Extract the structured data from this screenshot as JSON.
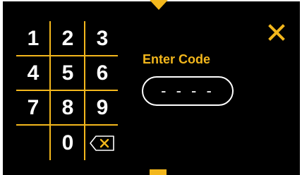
{
  "title": "Enter Code",
  "code_field": {
    "value": "- - - -"
  },
  "keypad": {
    "keys": [
      "1",
      "2",
      "3",
      "4",
      "5",
      "6",
      "7",
      "8",
      "9",
      "0"
    ]
  },
  "icons": {
    "close": "close-icon",
    "backspace": "backspace-icon"
  },
  "colors": {
    "accent": "#f3b71c",
    "background": "#000000",
    "text": "#ffffff"
  }
}
